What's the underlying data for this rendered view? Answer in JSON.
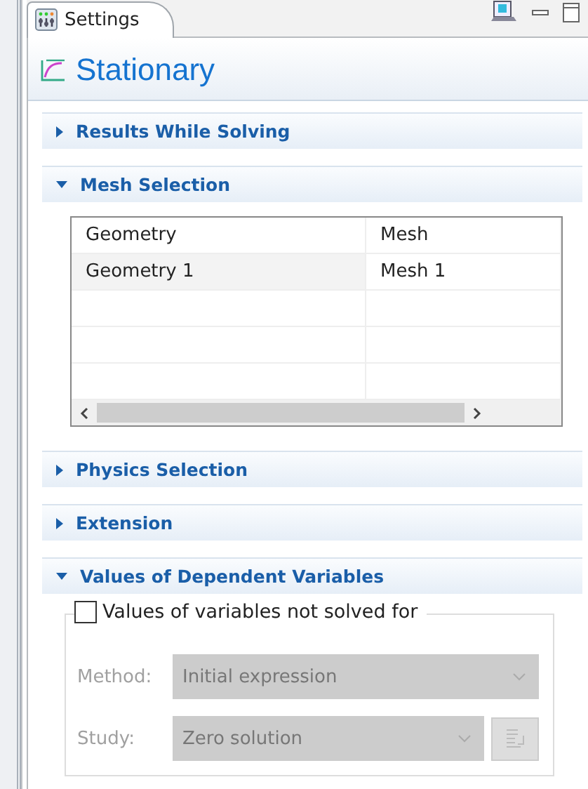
{
  "tab": {
    "label": "Settings",
    "selected": true
  },
  "title": "Stationary",
  "sections": [
    {
      "kind": "header",
      "label": "Results While Solving",
      "expanded": false
    },
    {
      "kind": "table",
      "label": "Mesh Selection",
      "expanded": true,
      "columns": [
        "Geometry",
        "Mesh"
      ],
      "rows": [
        {
          "cells": [
            "Geometry 1",
            "Mesh 1"
          ],
          "selected": true
        }
      ]
    },
    {
      "kind": "header",
      "label": "Physics Selection",
      "expanded": false
    },
    {
      "kind": "header",
      "label": "Extension",
      "expanded": false
    },
    {
      "kind": "group",
      "label": "Values of Dependent Variables",
      "expanded": true,
      "checkbox": {
        "label": "Values of variables not solved for",
        "checked": false
      },
      "fields": [
        {
          "kind": "dropdown",
          "label": "Method:",
          "value": "Initial expression",
          "disabled": true
        },
        {
          "kind": "dropdown_with_button",
          "label": "Study:",
          "value": "Zero solution",
          "disabled": true
        }
      ]
    }
  ]
}
